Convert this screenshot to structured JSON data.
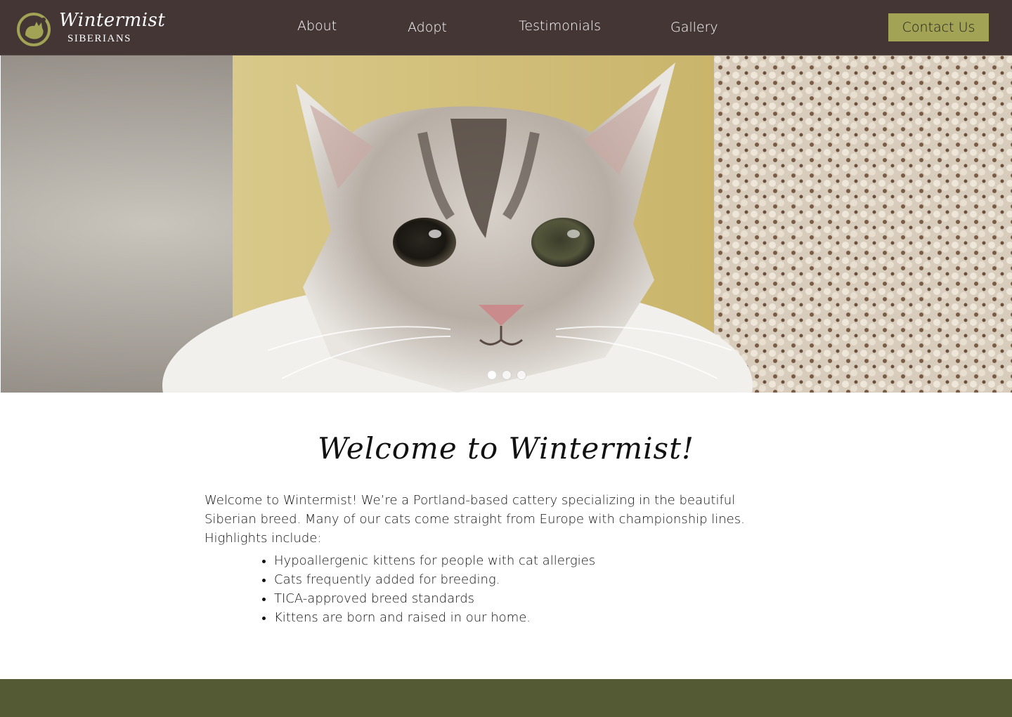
{
  "colors": {
    "header_bg": "#433635",
    "accent": "#a3a356",
    "footer_bg": "#545a33"
  },
  "brand": {
    "name": "Wintermist",
    "subtitle": "SIBERIANS",
    "icon": "cat-silhouette-logo"
  },
  "nav": {
    "items": [
      {
        "label": "About"
      },
      {
        "label": "Adopt"
      },
      {
        "label": "Testimonials"
      },
      {
        "label": "Gallery"
      }
    ],
    "contact_label": "Contact Us"
  },
  "hero": {
    "image": "fluffy-siberian-kitten-photo",
    "slide_count": 3,
    "active_slide": 1
  },
  "welcome": {
    "title": "Welcome to Wintermist!",
    "intro": "Welcome to Wintermist! We’re a Portland-based cattery specializing in the beautiful Siberian breed. Many of our cats come straight from Europe with championship lines. Highlights include:",
    "highlights": [
      "Hypoallergenic kittens for people with cat allergies",
      "Cats frequently added for breeding.",
      "TICA-approved breed standards",
      "Kittens are born and raised in our home."
    ]
  }
}
